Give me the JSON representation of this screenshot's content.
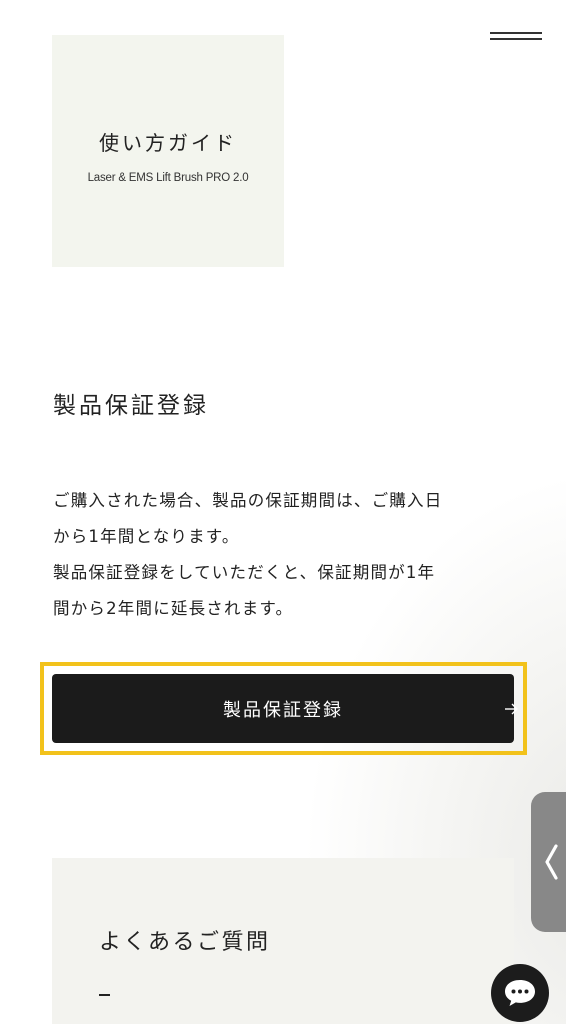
{
  "header": {
    "menu_icon": "hamburger-menu-icon"
  },
  "guide_card": {
    "title": "使い方ガイド",
    "subtitle": "Laser & EMS Lift Brush PRO 2.0"
  },
  "warranty": {
    "heading": "製品保証登録",
    "description_lines": [
      "ご購入された場合、製品の保証期間は、ご購入日",
      "から1年間となります。",
      "製品保証登録をしていただくと、保証期間が1年",
      "間から2年間に延長されます。"
    ],
    "button_label": "製品保証登録",
    "button_icon": "arrow-right-icon",
    "highlight_color": "#f2c21b"
  },
  "faq": {
    "title": "よくあるご質問"
  },
  "side_tab": {
    "icon": "chevron-left-icon"
  },
  "chat": {
    "icon": "chat-bubble-icon"
  },
  "colors": {
    "button_bg": "#1b1b1b",
    "card_bg": "#f3f5ee",
    "side_tab_bg": "#888888"
  }
}
